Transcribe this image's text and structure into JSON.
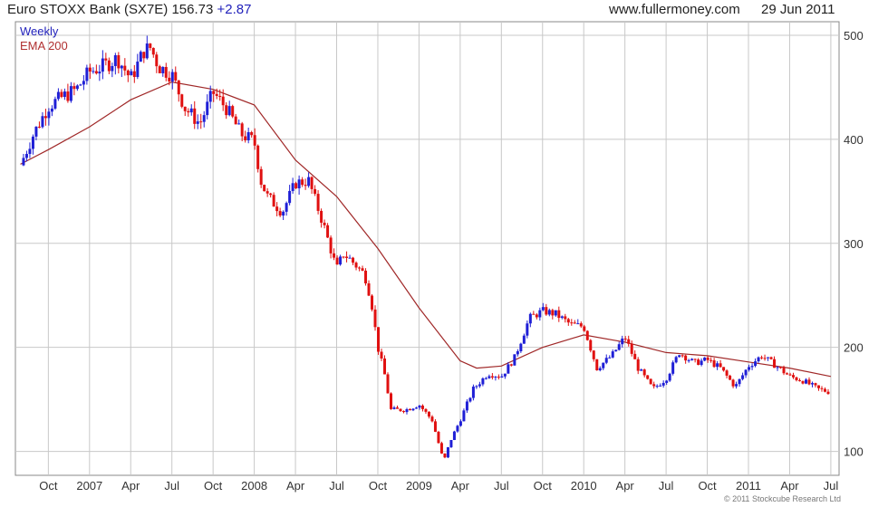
{
  "header": {
    "title": "Euro STOXX Bank (SX7E) 156.73",
    "change": "+2.87",
    "source": "www.fullermoney.com",
    "date": "29 Jun 2011"
  },
  "legend": {
    "weekly": "Weekly",
    "ema": "EMA 200"
  },
  "copyright": "© 2011 Stockcube Research Ltd",
  "colors": {
    "up": "#1f1fd6",
    "down": "#e01010",
    "ema": "#a02828",
    "grid": "#c8c8c8"
  },
  "chart_data": {
    "type": "line",
    "title": "Euro STOXX Bank (SX7E) 156.73 +2.87",
    "y_ticks": [
      100,
      200,
      300,
      400,
      500
    ],
    "ylim": [
      77,
      513
    ],
    "x_range": [
      2006.58,
      2011.53
    ],
    "x_ticks": [
      {
        "label": "Oct",
        "x": 2006.75
      },
      {
        "label": "2007",
        "x": 2007.0
      },
      {
        "label": "Apr",
        "x": 2007.25
      },
      {
        "label": "Jul",
        "x": 2007.5
      },
      {
        "label": "Oct",
        "x": 2007.75
      },
      {
        "label": "2008",
        "x": 2008.0
      },
      {
        "label": "Apr",
        "x": 2008.25
      },
      {
        "label": "Jul",
        "x": 2008.5
      },
      {
        "label": "Oct",
        "x": 2008.75
      },
      {
        "label": "2009",
        "x": 2009.0
      },
      {
        "label": "Apr",
        "x": 2009.25
      },
      {
        "label": "Jul",
        "x": 2009.5
      },
      {
        "label": "Oct",
        "x": 2009.75
      },
      {
        "label": "2010",
        "x": 2010.0
      },
      {
        "label": "Apr",
        "x": 2010.25
      },
      {
        "label": "Jul",
        "x": 2010.5
      },
      {
        "label": "Oct",
        "x": 2010.75
      },
      {
        "label": "2011",
        "x": 2011.0
      },
      {
        "label": "Apr",
        "x": 2011.25
      },
      {
        "label": "Jul",
        "x": 2011.5
      }
    ],
    "series": [
      {
        "name": "Weekly",
        "style": "candlestick",
        "x": [
          2006.58,
          2006.66,
          2006.75,
          2006.83,
          2006.92,
          2007.0,
          2007.08,
          2007.17,
          2007.25,
          2007.33,
          2007.37,
          2007.42,
          2007.5,
          2007.58,
          2007.67,
          2007.75,
          2007.83,
          2007.92,
          2008.0,
          2008.04,
          2008.08,
          2008.17,
          2008.25,
          2008.33,
          2008.42,
          2008.5,
          2008.54,
          2008.58,
          2008.67,
          2008.71,
          2008.75,
          2008.79,
          2008.83,
          2008.92,
          2009.0,
          2009.08,
          2009.15,
          2009.19,
          2009.25,
          2009.33,
          2009.42,
          2009.5,
          2009.58,
          2009.67,
          2009.75,
          2009.83,
          2009.92,
          2010.0,
          2010.08,
          2010.17,
          2010.25,
          2010.33,
          2010.42,
          2010.5,
          2010.58,
          2010.67,
          2010.75,
          2010.83,
          2010.92,
          2011.0,
          2011.08,
          2011.17,
          2011.25,
          2011.33,
          2011.42,
          2011.5
        ],
        "values": [
          375,
          405,
          432,
          440,
          448,
          465,
          470,
          478,
          458,
          485,
          488,
          470,
          462,
          430,
          415,
          445,
          430,
          405,
          398,
          360,
          345,
          330,
          358,
          360,
          318,
          275,
          290,
          285,
          270,
          245,
          200,
          175,
          140,
          140,
          145,
          130,
          90,
          110,
          130,
          160,
          175,
          172,
          190,
          228,
          235,
          232,
          222,
          220,
          180,
          192,
          210,
          180,
          160,
          170,
          195,
          185,
          188,
          180,
          162,
          182,
          192,
          182,
          172,
          168,
          160,
          156.73
        ]
      },
      {
        "name": "EMA 200",
        "x": [
          2006.58,
          2006.75,
          2007.0,
          2007.25,
          2007.5,
          2007.75,
          2008.0,
          2008.25,
          2008.5,
          2008.75,
          2009.0,
          2009.25,
          2009.35,
          2009.5,
          2009.75,
          2010.0,
          2010.25,
          2010.5,
          2010.75,
          2011.0,
          2011.25,
          2011.5
        ],
        "values": [
          376,
          390,
          412,
          438,
          455,
          448,
          433,
          380,
          345,
          295,
          238,
          187,
          180,
          182,
          200,
          212,
          205,
          195,
          192,
          186,
          180,
          172
        ]
      }
    ]
  }
}
